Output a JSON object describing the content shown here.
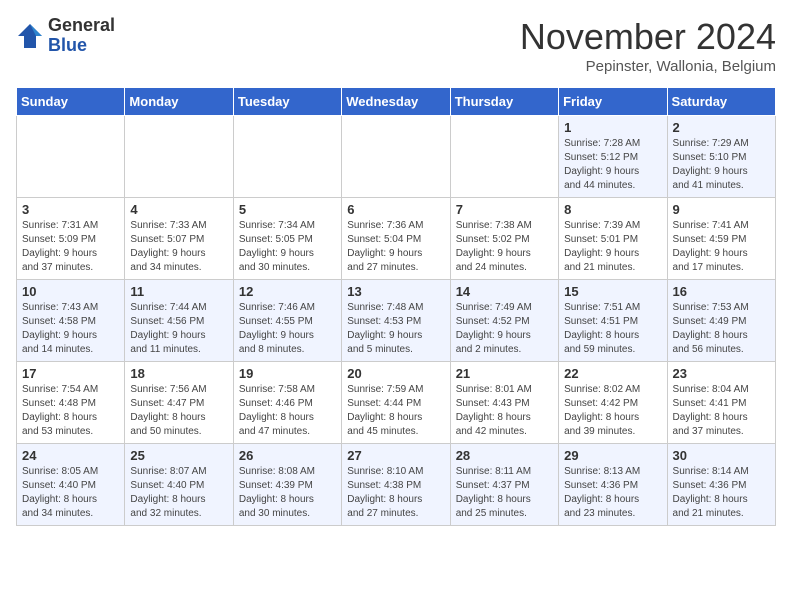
{
  "logo": {
    "general": "General",
    "blue": "Blue"
  },
  "title": "November 2024",
  "subtitle": "Pepinster, Wallonia, Belgium",
  "weekdays": [
    "Sunday",
    "Monday",
    "Tuesday",
    "Wednesday",
    "Thursday",
    "Friday",
    "Saturday"
  ],
  "weeks": [
    [
      {
        "day": "",
        "info": ""
      },
      {
        "day": "",
        "info": ""
      },
      {
        "day": "",
        "info": ""
      },
      {
        "day": "",
        "info": ""
      },
      {
        "day": "",
        "info": ""
      },
      {
        "day": "1",
        "info": "Sunrise: 7:28 AM\nSunset: 5:12 PM\nDaylight: 9 hours\nand 44 minutes."
      },
      {
        "day": "2",
        "info": "Sunrise: 7:29 AM\nSunset: 5:10 PM\nDaylight: 9 hours\nand 41 minutes."
      }
    ],
    [
      {
        "day": "3",
        "info": "Sunrise: 7:31 AM\nSunset: 5:09 PM\nDaylight: 9 hours\nand 37 minutes."
      },
      {
        "day": "4",
        "info": "Sunrise: 7:33 AM\nSunset: 5:07 PM\nDaylight: 9 hours\nand 34 minutes."
      },
      {
        "day": "5",
        "info": "Sunrise: 7:34 AM\nSunset: 5:05 PM\nDaylight: 9 hours\nand 30 minutes."
      },
      {
        "day": "6",
        "info": "Sunrise: 7:36 AM\nSunset: 5:04 PM\nDaylight: 9 hours\nand 27 minutes."
      },
      {
        "day": "7",
        "info": "Sunrise: 7:38 AM\nSunset: 5:02 PM\nDaylight: 9 hours\nand 24 minutes."
      },
      {
        "day": "8",
        "info": "Sunrise: 7:39 AM\nSunset: 5:01 PM\nDaylight: 9 hours\nand 21 minutes."
      },
      {
        "day": "9",
        "info": "Sunrise: 7:41 AM\nSunset: 4:59 PM\nDaylight: 9 hours\nand 17 minutes."
      }
    ],
    [
      {
        "day": "10",
        "info": "Sunrise: 7:43 AM\nSunset: 4:58 PM\nDaylight: 9 hours\nand 14 minutes."
      },
      {
        "day": "11",
        "info": "Sunrise: 7:44 AM\nSunset: 4:56 PM\nDaylight: 9 hours\nand 11 minutes."
      },
      {
        "day": "12",
        "info": "Sunrise: 7:46 AM\nSunset: 4:55 PM\nDaylight: 9 hours\nand 8 minutes."
      },
      {
        "day": "13",
        "info": "Sunrise: 7:48 AM\nSunset: 4:53 PM\nDaylight: 9 hours\nand 5 minutes."
      },
      {
        "day": "14",
        "info": "Sunrise: 7:49 AM\nSunset: 4:52 PM\nDaylight: 9 hours\nand 2 minutes."
      },
      {
        "day": "15",
        "info": "Sunrise: 7:51 AM\nSunset: 4:51 PM\nDaylight: 8 hours\nand 59 minutes."
      },
      {
        "day": "16",
        "info": "Sunrise: 7:53 AM\nSunset: 4:49 PM\nDaylight: 8 hours\nand 56 minutes."
      }
    ],
    [
      {
        "day": "17",
        "info": "Sunrise: 7:54 AM\nSunset: 4:48 PM\nDaylight: 8 hours\nand 53 minutes."
      },
      {
        "day": "18",
        "info": "Sunrise: 7:56 AM\nSunset: 4:47 PM\nDaylight: 8 hours\nand 50 minutes."
      },
      {
        "day": "19",
        "info": "Sunrise: 7:58 AM\nSunset: 4:46 PM\nDaylight: 8 hours\nand 47 minutes."
      },
      {
        "day": "20",
        "info": "Sunrise: 7:59 AM\nSunset: 4:44 PM\nDaylight: 8 hours\nand 45 minutes."
      },
      {
        "day": "21",
        "info": "Sunrise: 8:01 AM\nSunset: 4:43 PM\nDaylight: 8 hours\nand 42 minutes."
      },
      {
        "day": "22",
        "info": "Sunrise: 8:02 AM\nSunset: 4:42 PM\nDaylight: 8 hours\nand 39 minutes."
      },
      {
        "day": "23",
        "info": "Sunrise: 8:04 AM\nSunset: 4:41 PM\nDaylight: 8 hours\nand 37 minutes."
      }
    ],
    [
      {
        "day": "24",
        "info": "Sunrise: 8:05 AM\nSunset: 4:40 PM\nDaylight: 8 hours\nand 34 minutes."
      },
      {
        "day": "25",
        "info": "Sunrise: 8:07 AM\nSunset: 4:40 PM\nDaylight: 8 hours\nand 32 minutes."
      },
      {
        "day": "26",
        "info": "Sunrise: 8:08 AM\nSunset: 4:39 PM\nDaylight: 8 hours\nand 30 minutes."
      },
      {
        "day": "27",
        "info": "Sunrise: 8:10 AM\nSunset: 4:38 PM\nDaylight: 8 hours\nand 27 minutes."
      },
      {
        "day": "28",
        "info": "Sunrise: 8:11 AM\nSunset: 4:37 PM\nDaylight: 8 hours\nand 25 minutes."
      },
      {
        "day": "29",
        "info": "Sunrise: 8:13 AM\nSunset: 4:36 PM\nDaylight: 8 hours\nand 23 minutes."
      },
      {
        "day": "30",
        "info": "Sunrise: 8:14 AM\nSunset: 4:36 PM\nDaylight: 8 hours\nand 21 minutes."
      }
    ]
  ]
}
